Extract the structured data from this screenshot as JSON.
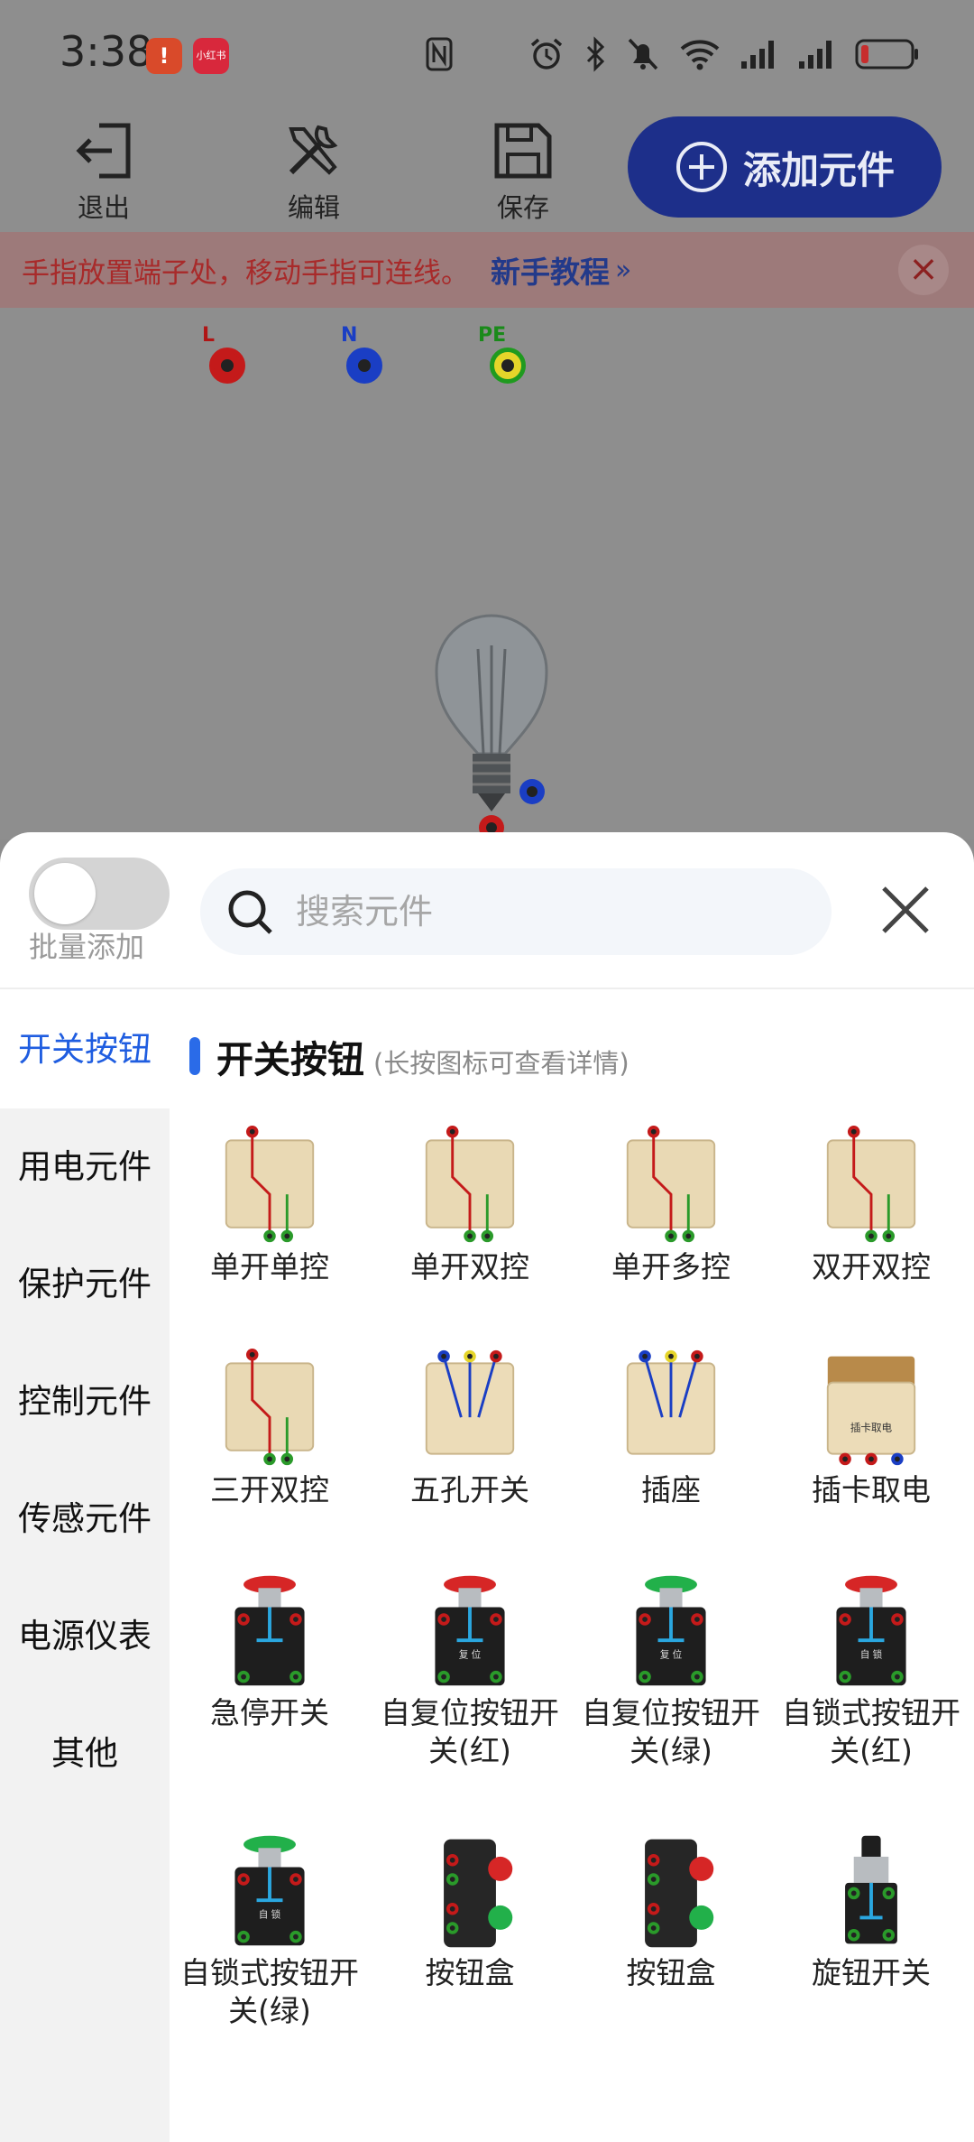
{
  "status_bar": {
    "time": "3:38",
    "badge_app1": "!",
    "badge_app2": "小红书"
  },
  "toolbar": {
    "exit_label": "退出",
    "edit_label": "编辑",
    "save_label": "保存",
    "add_label": "添加元件"
  },
  "tip": {
    "text": "手指放置端子处，移动手指可连线。",
    "link": "新手教程",
    "link_arrow": "»"
  },
  "canvas": {
    "terminals": [
      {
        "label": "L",
        "color": "#c41a1a"
      },
      {
        "label": "N",
        "color": "#1a3ec4"
      },
      {
        "label": "PE",
        "color": "#1f9a1f"
      }
    ]
  },
  "sheet": {
    "batch_toggle_label": "批量添加",
    "batch_toggle_on": false,
    "search_placeholder": "搜索元件",
    "categories": [
      {
        "label": "开关按钮",
        "active": true
      },
      {
        "label": "用电元件",
        "active": false
      },
      {
        "label": "保护元件",
        "active": false
      },
      {
        "label": "控制元件",
        "active": false
      },
      {
        "label": "传感元件",
        "active": false
      },
      {
        "label": "电源仪表",
        "active": false
      },
      {
        "label": "其他",
        "active": false
      }
    ],
    "section_title": "开关按钮",
    "section_hint": "(长按图标可查看详情)",
    "components": [
      {
        "label": "单开单控",
        "icon": "switch-panel"
      },
      {
        "label": "单开双控",
        "icon": "switch-panel"
      },
      {
        "label": "单开多控",
        "icon": "switch-panel"
      },
      {
        "label": "双开双控",
        "icon": "switch-panel"
      },
      {
        "label": "三开双控",
        "icon": "switch-panel"
      },
      {
        "label": "五孔开关",
        "icon": "outlet-switch"
      },
      {
        "label": "插座",
        "icon": "outlet"
      },
      {
        "label": "插卡取电",
        "icon": "card-switch",
        "icon_text": "插卡取电"
      },
      {
        "label": "急停开关",
        "icon": "push-button",
        "cap": "#d62626"
      },
      {
        "label": "自复位按钮开关(红)",
        "icon": "push-button",
        "cap": "#d62626",
        "icon_text": "复 位"
      },
      {
        "label": "自复位按钮开关(绿)",
        "icon": "push-button",
        "cap": "#22b04a",
        "icon_text": "复 位"
      },
      {
        "label": "自锁式按钮开关(红)",
        "icon": "push-button",
        "cap": "#d62626",
        "icon_text": "自 锁"
      },
      {
        "label": "自锁式按钮开关(绿)",
        "icon": "push-button",
        "cap": "#22b04a",
        "icon_text": "自 锁"
      },
      {
        "label": "按钮盒",
        "icon": "button-box"
      },
      {
        "label": "按钮盒",
        "icon": "button-box"
      },
      {
        "label": "旋钮开关",
        "icon": "rotary-switch"
      }
    ]
  }
}
